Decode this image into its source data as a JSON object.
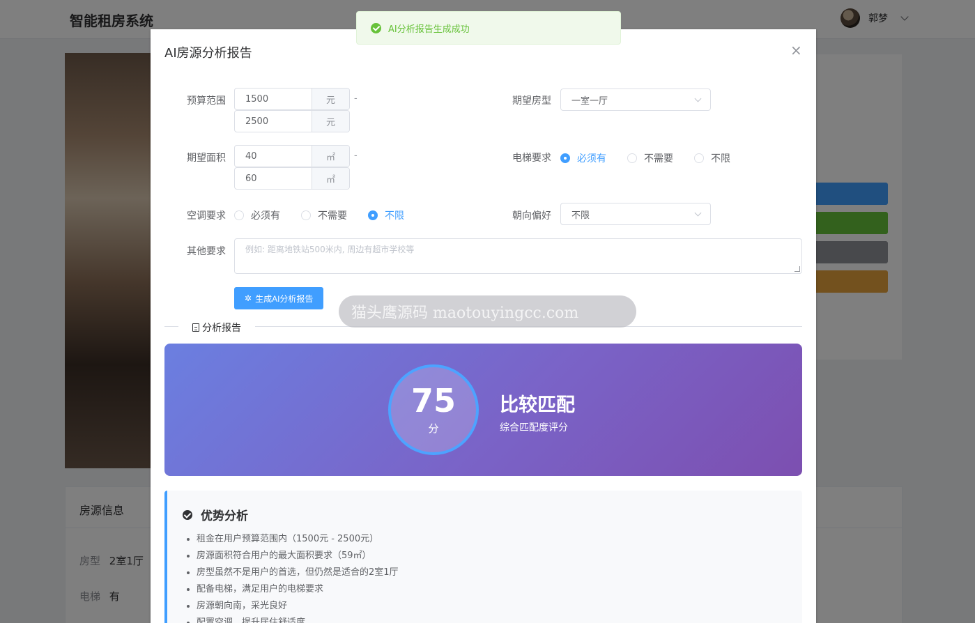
{
  "app": {
    "title": "智能租房系统",
    "user_name": "郭梦"
  },
  "background": {
    "info_title": "房源信息",
    "rows": [
      {
        "key": "房型",
        "value": "2室1厅"
      },
      {
        "key": "电梯",
        "value": "有"
      }
    ],
    "side_button_colors": [
      "#409eff",
      "#67c23a",
      "#909399",
      "#e6a23c"
    ]
  },
  "toast": {
    "message": "AI分析报告生成成功",
    "color": "#67c23a"
  },
  "dialog": {
    "title": "AI房源分析报告",
    "close_symbol": "×",
    "form": {
      "budget": {
        "label": "预算范围",
        "min": "1500",
        "max": "2500",
        "unit": "元",
        "separator": "-"
      },
      "area": {
        "label": "期望面积",
        "min": "40",
        "max": "60",
        "unit": "㎡",
        "separator": "-"
      },
      "room_type": {
        "label": "期望房型",
        "value": "一室一厅"
      },
      "elevator": {
        "label": "电梯要求",
        "options": [
          "必须有",
          "不需要",
          "不限"
        ],
        "selected": "必须有"
      },
      "ac": {
        "label": "空调要求",
        "options": [
          "必须有",
          "不需要",
          "不限"
        ],
        "selected": "不限"
      },
      "orientation": {
        "label": "朝向偏好",
        "value": "不限"
      },
      "other": {
        "label": "其他要求",
        "placeholder": "例如: 距离地铁站500米内, 周边有超市学校等"
      },
      "generate_button": "生成AI分析报告"
    },
    "report": {
      "divider_label": "分析报告",
      "score": 75,
      "score_unit": "分",
      "level": "比较匹配",
      "level_sub": "综合匹配度评分",
      "advantages_title": "优势分析",
      "advantages": [
        "租金在用户预算范围内（1500元 - 2500元）",
        "房源面积符合用户的最大面积要求（59㎡）",
        "房型虽然不是用户的首选，但仍然是适合的2室1厅",
        "配备电梯，满足用户的电梯要求",
        "房源朝向南，采光良好",
        "配置空调，提升居住舒适度"
      ]
    }
  },
  "watermark": "猫头鹰源码 maotouyingcc.com"
}
